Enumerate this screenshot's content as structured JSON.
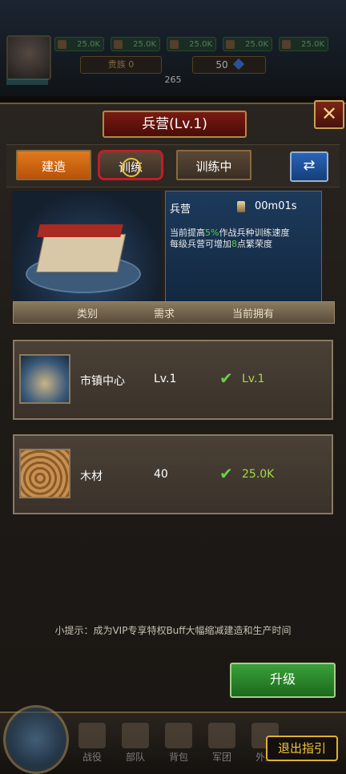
{
  "top": {
    "resources": [
      "25.0K",
      "25.0K",
      "25.0K",
      "25.0K",
      "25.0K"
    ],
    "nobility_label": "贵族 0",
    "gems": "50",
    "power": "265"
  },
  "panel": {
    "title": "兵营(Lv.1)",
    "close_icon": "close-icon"
  },
  "tabs": {
    "build": "建造",
    "train": "训练",
    "training": "训练中",
    "swap_icon": "swap-icon"
  },
  "building": {
    "name": "兵营",
    "timer": "00m01s",
    "desc_prefix": "当前提高",
    "desc_pct": "5%",
    "desc_mid": "作战兵种训练速度",
    "desc_line2_prefix": "每级兵营可增加",
    "desc_num": "8",
    "desc_line2_suffix": "点繁荣度"
  },
  "table": {
    "headers": [
      "类别",
      "需求",
      "当前拥有"
    ],
    "rows": [
      {
        "name": "市镇中心",
        "need": "Lv.1",
        "have": "Lv.1",
        "icon": "town-center-icon"
      },
      {
        "name": "木材",
        "need": "40",
        "have": "25.0K",
        "icon": "wood-icon"
      }
    ]
  },
  "tip": "小提示：成为VIP专享特权Buff大幅缩减建造和生产时间",
  "upgrade_label": "升级",
  "nav": [
    "战役",
    "部队",
    "背包",
    "军团",
    "外交"
  ],
  "exit_guide": "退出指引",
  "colors": {
    "accent": "#e07a1c",
    "ok": "#6bd14b",
    "upgrade": "#2a8a2a",
    "highlight": "#c21d2a"
  }
}
